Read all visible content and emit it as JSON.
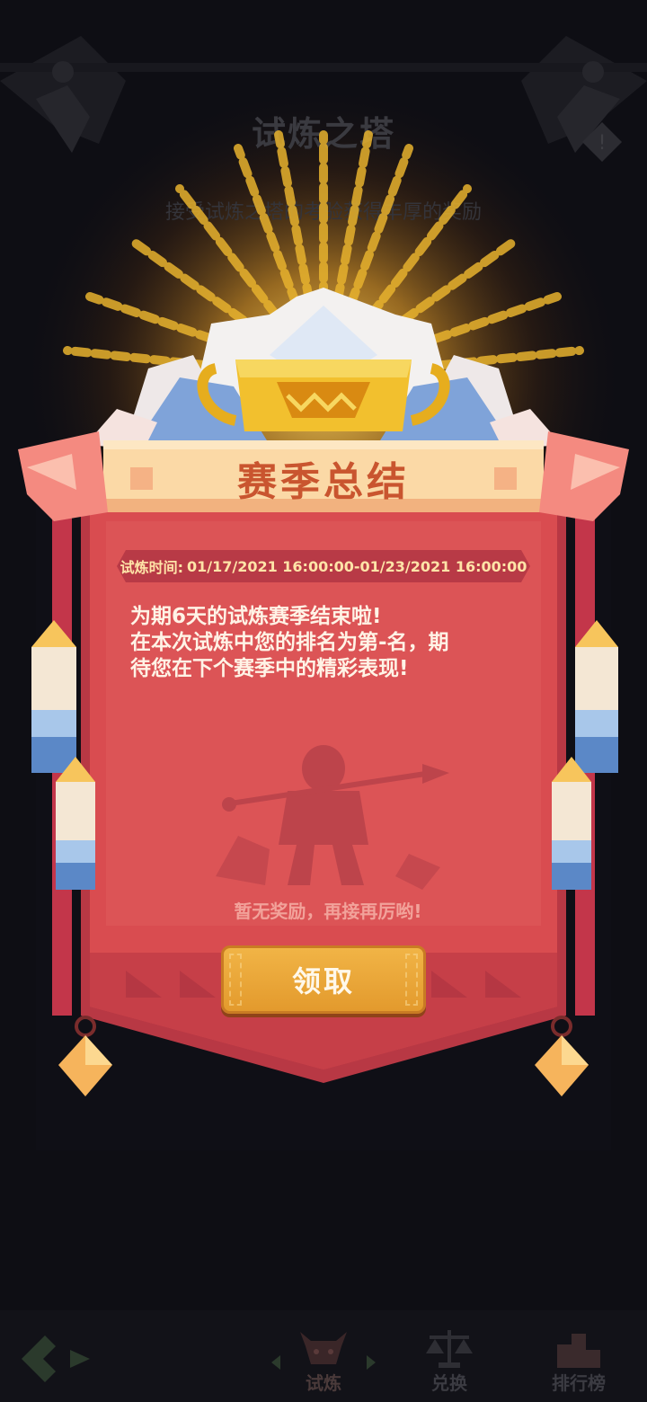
{
  "background": {
    "title": "试炼之塔",
    "subtitle": "接受试炼之塔的考验获得丰厚的奖励"
  },
  "dialog": {
    "title": "赛季总结",
    "time_label": "试炼时间:",
    "time_range": "01/17/2021 16:00:00-01/23/2021 16:00:00",
    "message_lines": [
      "为期6天的试炼赛季结束啦!",
      "在本次试炼中您的排名为第-名，期",
      "待您在下个赛季中的精彩表现!"
    ],
    "no_reward_text": "暂无奖励，再接再厉哟!",
    "claim_button": "领取"
  },
  "bottom_nav": {
    "tabs": [
      {
        "label": "试炼",
        "icon": "bull-skull-icon"
      },
      {
        "label": "兑换",
        "icon": "scale-icon"
      },
      {
        "label": "排行榜",
        "icon": "ranking-podium-icon"
      }
    ]
  },
  "colors": {
    "banner_red": "#d94c50",
    "title_scroll": "#fbd9a6",
    "title_text": "#c9552f",
    "button_orange": "#eba83a"
  }
}
